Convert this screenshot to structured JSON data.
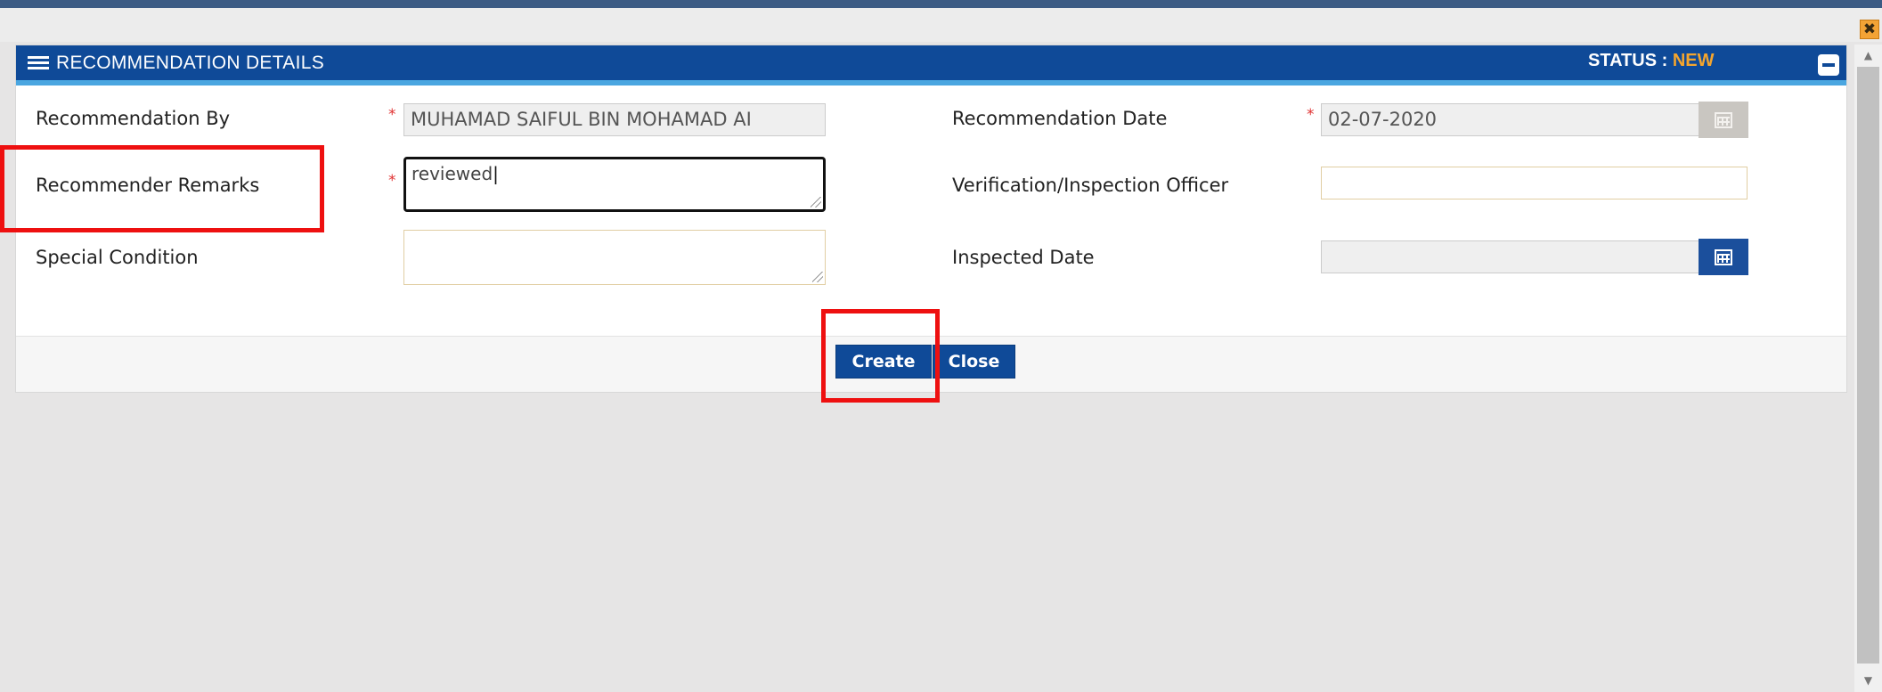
{
  "window": {
    "close_glyph": "✖"
  },
  "panel": {
    "title": "RECOMMENDATION DETAILS",
    "status_label": "STATUS : ",
    "status_value": "NEW",
    "status_color": "#f4a52e",
    "header_color": "#0f4a98"
  },
  "form": {
    "recommendation_by": {
      "label": "Recommendation By",
      "value": "MUHAMAD SAIFUL BIN MOHAMAD AI",
      "required": "*"
    },
    "recommendation_date": {
      "label": "Recommendation Date",
      "value": "02-07-2020",
      "required": "*"
    },
    "recommender_remarks": {
      "label": "Recommender Remarks",
      "value": "reviewed",
      "required": "*"
    },
    "verification_officer": {
      "label": "Verification/Inspection Officer",
      "value": ""
    },
    "special_condition": {
      "label": "Special Condition",
      "value": ""
    },
    "inspected_date": {
      "label": "Inspected Date",
      "value": ""
    }
  },
  "buttons": {
    "create": "Create",
    "close": "Close"
  },
  "icons": {
    "calendar": "calendar-icon",
    "menu": "menu-icon",
    "collapse": "minus-icon"
  }
}
